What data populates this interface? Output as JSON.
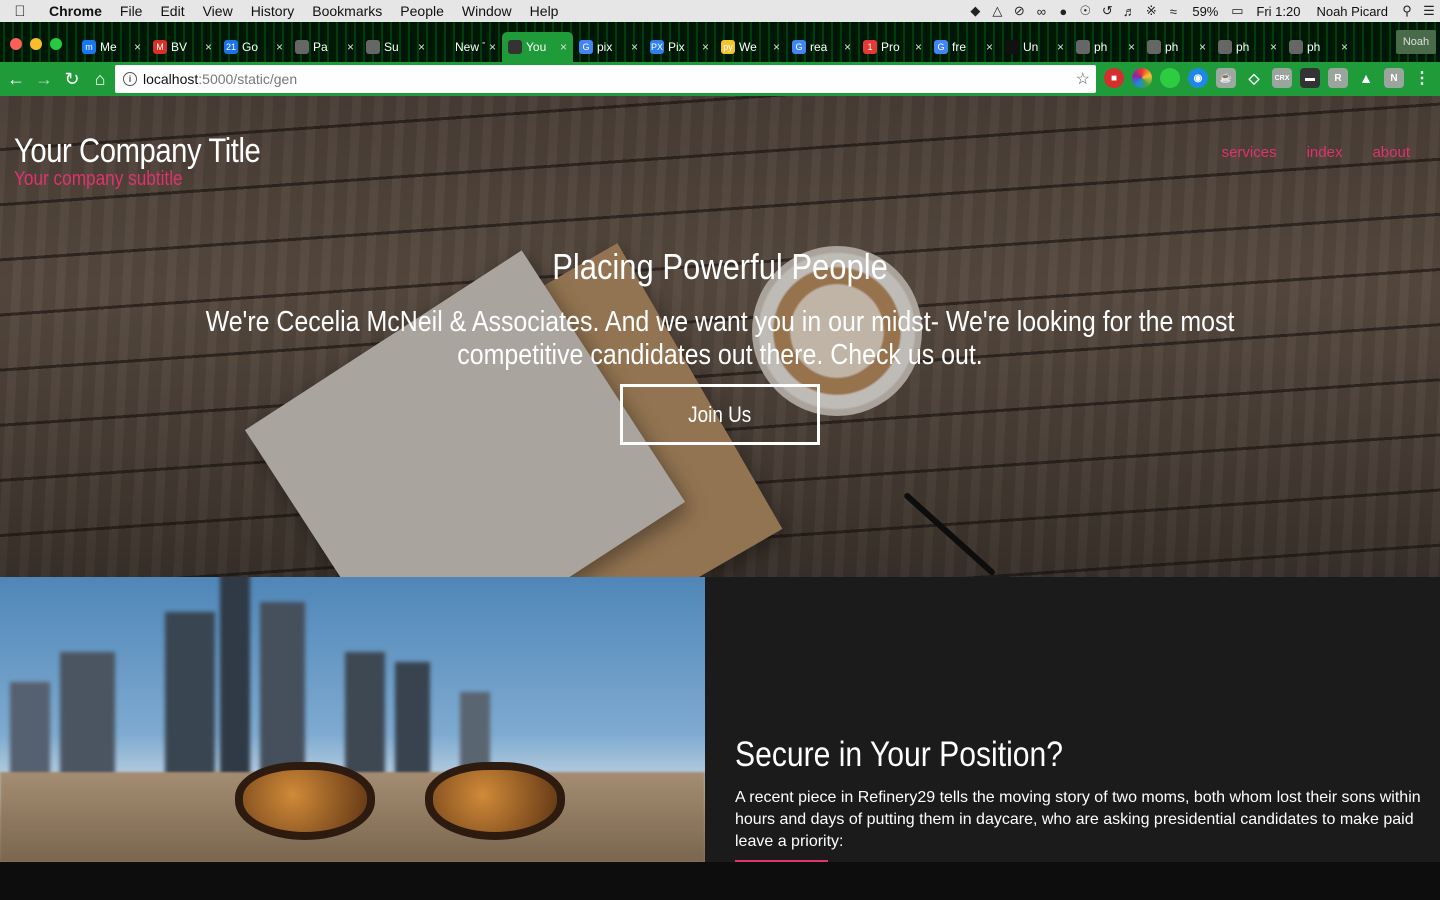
{
  "menubar": {
    "app": "Chrome",
    "items": [
      "File",
      "Edit",
      "View",
      "History",
      "Bookmarks",
      "People",
      "Window",
      "Help"
    ],
    "battery": "59%",
    "time": "Fri 1:20",
    "user": "Noah Picard"
  },
  "tabs": [
    {
      "title": "Me",
      "color": "#1877f2",
      "glyph": "m"
    },
    {
      "title": "BV",
      "color": "#d93025",
      "glyph": "M"
    },
    {
      "title": "Go",
      "color": "#1a73e8",
      "glyph": "21"
    },
    {
      "title": "Pa",
      "color": "#666666",
      "glyph": ""
    },
    {
      "title": "Su",
      "color": "#666666",
      "glyph": ""
    },
    {
      "title": "New T",
      "color": "",
      "glyph": ""
    },
    {
      "title": "You",
      "color": "#333333",
      "glyph": "",
      "active": true
    },
    {
      "title": "pix",
      "color": "#4285f4",
      "glyph": "G"
    },
    {
      "title": "Pix",
      "color": "#2f80ed",
      "glyph": "PX"
    },
    {
      "title": "We",
      "color": "#f4c430",
      "glyph": "py"
    },
    {
      "title": "rea",
      "color": "#4285f4",
      "glyph": "G"
    },
    {
      "title": "Pro",
      "color": "#e53935",
      "glyph": "1"
    },
    {
      "title": "fre",
      "color": "#4285f4",
      "glyph": "G"
    },
    {
      "title": "Un",
      "color": "#111111",
      "glyph": ""
    },
    {
      "title": "ph",
      "color": "#666666",
      "glyph": ""
    },
    {
      "title": "ph",
      "color": "#666666",
      "glyph": ""
    },
    {
      "title": "ph",
      "color": "#666666",
      "glyph": ""
    },
    {
      "title": "ph",
      "color": "#666666",
      "glyph": ""
    }
  ],
  "profile": "Noah",
  "omnibox": {
    "host": "localhost",
    "path": ":5000/static/gen"
  },
  "site": {
    "title": "Your Company Title",
    "subtitle": "Your company subtitle",
    "nav": [
      "services",
      "index",
      "about"
    ],
    "hero_heading": "Placing Powerful People",
    "hero_text": "We're Cecelia McNeil & Associates. And we want you in our midst- We're looking for the most competitive candidates out there. Check us out.",
    "cta": "Join Us",
    "section_heading": "Secure in Your Position?",
    "section_text": "A recent piece in Refinery29 tells the moving story of two moms, both whom lost their sons within hours and days of putting them in daycare, who are asking presidential candidates to make paid leave a priority:"
  },
  "colors": {
    "accent": "#e0326e",
    "toolbar": "#1f9b3a",
    "panel": "#1c1b1b"
  }
}
